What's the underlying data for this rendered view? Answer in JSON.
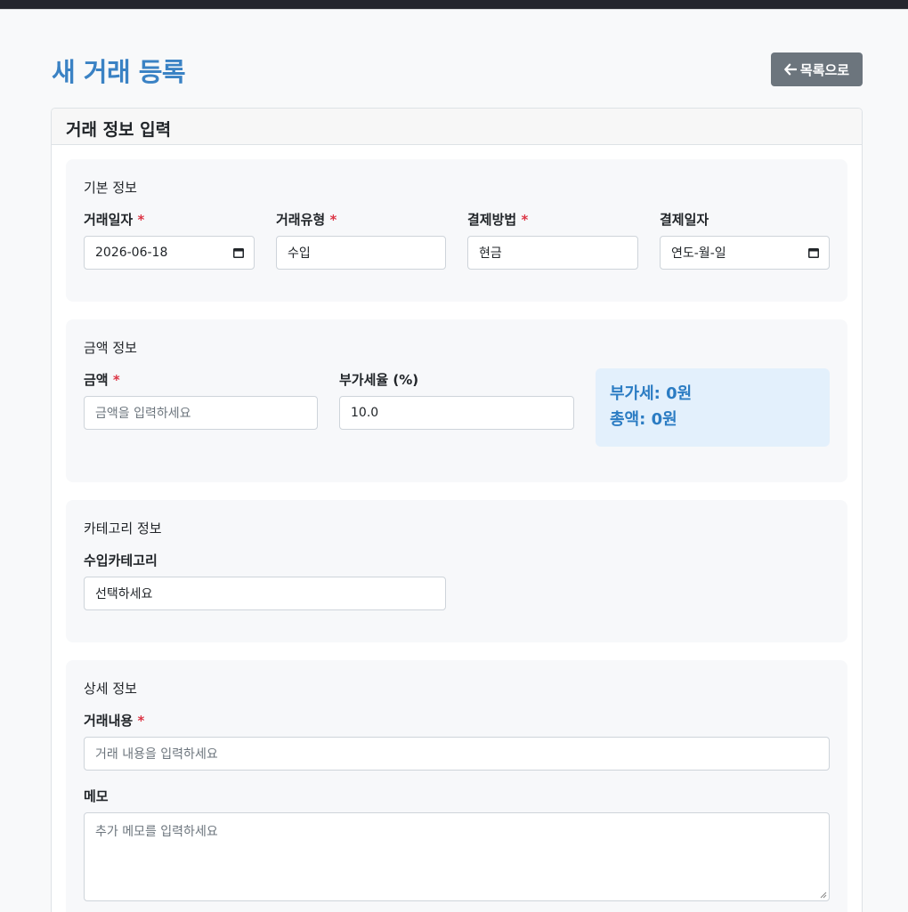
{
  "page": {
    "title": "새 거래 등록",
    "back_button_label": "목록으로"
  },
  "card": {
    "header": "거래 정보 입력"
  },
  "basic": {
    "title": "기본 정보",
    "date_label": "거래일자",
    "date_value": "2026-06-18",
    "type_label": "거래유형",
    "type_value": "수입",
    "method_label": "결제방법",
    "method_value": "현금",
    "pay_date_label": "결제일자",
    "pay_date_placeholder": "연도-월-일",
    "required_mark": "*"
  },
  "amount": {
    "title": "금액 정보",
    "amount_label": "금액",
    "amount_placeholder": "금액을 입력하세요",
    "vat_rate_label": "부가세율 (%)",
    "vat_rate_value": "10.0",
    "vat_text": "부가세: 0원",
    "total_text": "총액: 0원"
  },
  "category": {
    "title": "카테고리 정보",
    "income_category_label": "수입카테고리",
    "income_category_value": "선택하세요"
  },
  "detail": {
    "title": "상세 정보",
    "content_label": "거래내용",
    "content_placeholder": "거래 내용을 입력하세요",
    "memo_label": "메모",
    "memo_placeholder": "추가 메모를 입력하세요"
  },
  "colors": {
    "title": "#3a82c4",
    "required": "#dc3545",
    "back_button": "#6c757d",
    "calc_box_bg": "#e3f0fc",
    "calc_box_text": "#2b7cc3"
  },
  "icons": {
    "back": "arrow-left-icon",
    "calendar": "calendar-icon"
  }
}
